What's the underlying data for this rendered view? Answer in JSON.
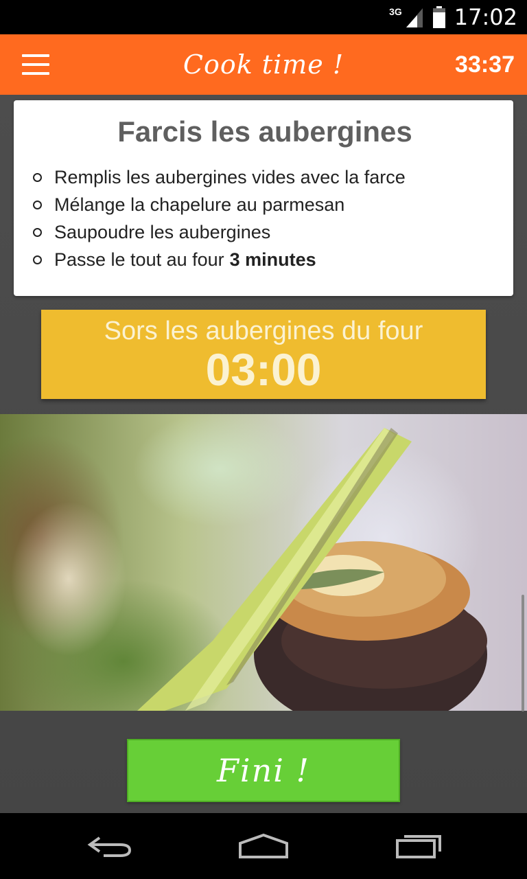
{
  "status_bar": {
    "network": "3G",
    "time": "17:02"
  },
  "app_bar": {
    "title": "Cook time !",
    "timer": "33:37",
    "menu_icon": "hamburger-menu-icon"
  },
  "step": {
    "title": "Farcis les aubergines",
    "items": [
      {
        "text": "Remplis les aubergines vides avec la farce",
        "bold": ""
      },
      {
        "text": "Mélange la chapelure au parmesan",
        "bold": ""
      },
      {
        "text": "Saupoudre les aubergines",
        "bold": ""
      },
      {
        "text": "Passe le tout au four",
        "bold": "3 minutes"
      }
    ]
  },
  "timer": {
    "label": "Sors les aubergines du four",
    "value": "03:00"
  },
  "done_button": {
    "label": "Fini !"
  },
  "colors": {
    "app_bar": "#ff6a1f",
    "timer_box": "#efbc2f",
    "done_button": "#67cf37"
  },
  "nav_bar": {
    "back_icon": "back-icon",
    "home_icon": "home-icon",
    "recents_icon": "recent-apps-icon"
  }
}
